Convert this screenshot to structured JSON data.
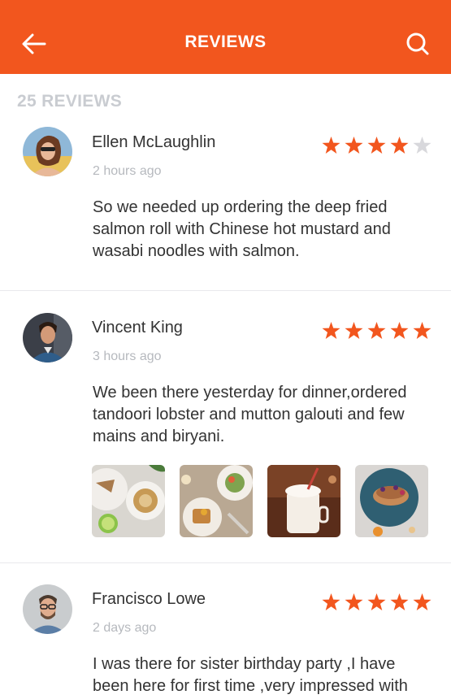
{
  "header": {
    "title": "REVIEWS",
    "background": "#F2561E",
    "back_icon": "arrow-left-icon",
    "search_icon": "search-icon"
  },
  "reviews_count": "25 REVIEWS",
  "colors": {
    "star_filled": "#F2561E",
    "star_empty": "#D8D8DC"
  },
  "reviews": [
    {
      "name": "Ellen McLaughlin",
      "time": "2 hours ago",
      "rating": 4,
      "text": "So we needed up ordering the deep fried salmon roll with Chinese hot mustard and wasabi noodles with salmon."
    },
    {
      "name": "Vincent King",
      "time": "3 hours ago",
      "rating": 5,
      "text": "We been there yesterday for dinner,ordered tandoori lobster and mutton galouti and few mains and biryani.",
      "photos": [
        "coffee-and-snacks-photo",
        "brunch-plates-photo",
        "milkshake-photo",
        "pancake-plate-photo"
      ]
    },
    {
      "name": "Francisco Lowe",
      "time": "2 days ago",
      "rating": 5,
      "text": "I was there for sister birthday party ,I have been here for first time ,very impressed with"
    }
  ]
}
